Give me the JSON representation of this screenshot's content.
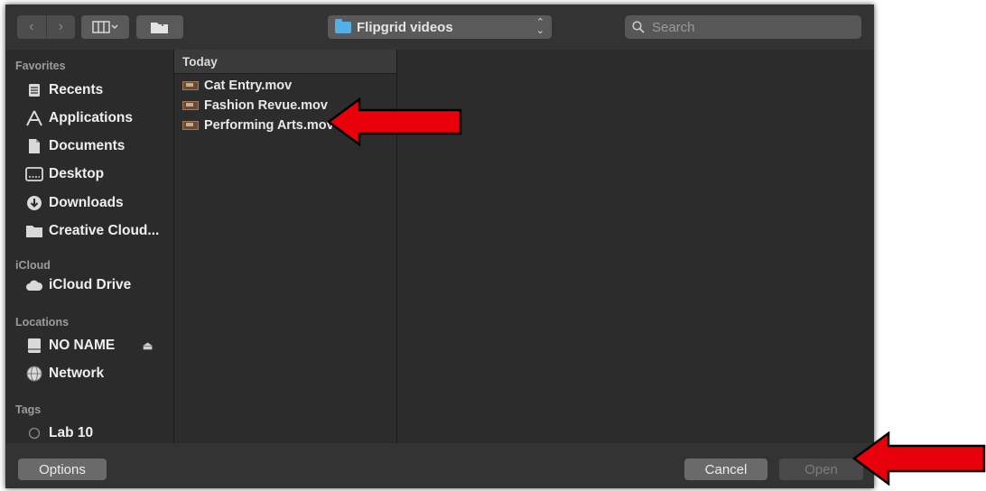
{
  "toolbar": {
    "back_icon": "chevron-left-icon",
    "forward_icon": "chevron-right-icon",
    "view_icon": "columns-view-icon",
    "new_folder_icon": "new-folder-icon",
    "location": "Flipgrid videos",
    "search_placeholder": "Search"
  },
  "sidebar": {
    "favorites_label": "Favorites",
    "favorites": [
      {
        "label": "Recents",
        "icon": "recents-icon"
      },
      {
        "label": "Applications",
        "icon": "applications-icon"
      },
      {
        "label": "Documents",
        "icon": "documents-icon"
      },
      {
        "label": "Desktop",
        "icon": "desktop-icon"
      },
      {
        "label": "Downloads",
        "icon": "downloads-icon"
      },
      {
        "label": "Creative Cloud...",
        "icon": "folder-icon"
      }
    ],
    "icloud_label": "iCloud",
    "icloud": [
      {
        "label": "iCloud Drive",
        "icon": "cloud-icon"
      }
    ],
    "locations_label": "Locations",
    "locations": [
      {
        "label": "NO NAME",
        "icon": "drive-icon",
        "eject": "⏏"
      },
      {
        "label": "Network",
        "icon": "network-icon"
      }
    ],
    "tags_label": "Tags",
    "tags": [
      {
        "label": "Lab 10",
        "icon": "tag-circle-icon"
      }
    ]
  },
  "files": {
    "header": "Today",
    "items": [
      {
        "name": "Cat Entry.mov",
        "icon": "movie-file-icon"
      },
      {
        "name": "Fashion Revue.mov",
        "icon": "movie-file-icon"
      },
      {
        "name": "Performing Arts.mov",
        "icon": "movie-file-icon"
      }
    ]
  },
  "footer": {
    "options_label": "Options",
    "cancel_label": "Cancel",
    "open_label": "Open"
  },
  "annotations": {
    "arrow_color": "#e8000b"
  }
}
